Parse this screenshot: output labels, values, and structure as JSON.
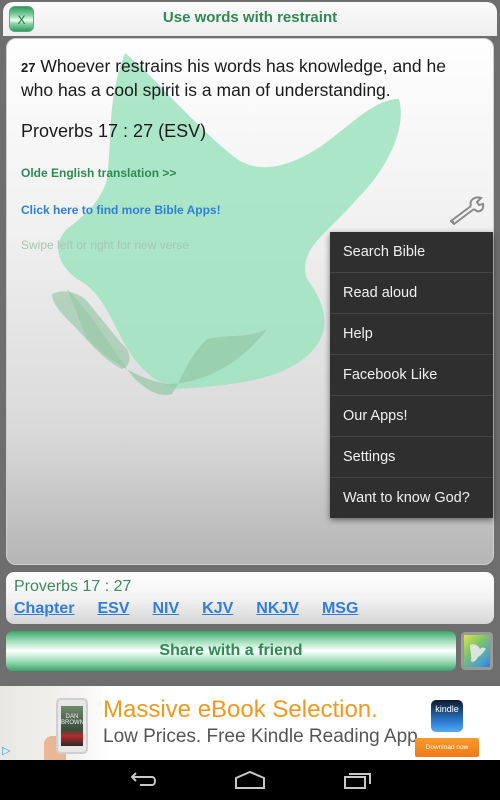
{
  "header": {
    "title": "Use words with restraint",
    "close_label": "X"
  },
  "verse": {
    "number": "27",
    "text": "Whoever restrains his words has knowledge, and he who has a cool spirit is a man of understanding.",
    "reference": "Proverbs 17 : 27  (ESV)"
  },
  "links": {
    "olde_english": "Olde English translation >>",
    "more_apps": "Click here to find more Bible Apps!",
    "swipe_hint": "Swipe left or right for new verse"
  },
  "menu": {
    "items": [
      {
        "label": "Search Bible"
      },
      {
        "label": "Read aloud"
      },
      {
        "label": "Help"
      },
      {
        "label": "Facebook Like"
      },
      {
        "label": "Our Apps!"
      },
      {
        "label": "Settings"
      },
      {
        "label": "Want to know God?"
      }
    ]
  },
  "ref_panel": {
    "title": "Proverbs 17 : 27",
    "versions": [
      {
        "label": "Chapter"
      },
      {
        "label": "ESV"
      },
      {
        "label": "NIV"
      },
      {
        "label": "KJV"
      },
      {
        "label": "NKJV"
      },
      {
        "label": "MSG"
      }
    ]
  },
  "share": {
    "label": "Share with a friend"
  },
  "ad": {
    "headline": "Massive eBook Selection.",
    "subline": "Low Prices. Free Kindle Reading App.",
    "book_author": "DAN BROWN",
    "kindle_label": "kindle",
    "download_label": "Download now",
    "ad_choices_glyph": "▷"
  },
  "icons": {
    "wrench": "wrench-icon",
    "back": "back-icon",
    "home": "home-icon",
    "recents": "recents-icon"
  },
  "colors": {
    "accent_green": "#2e8a52",
    "link_blue": "#2f7fd8",
    "ad_orange": "#ef9a1e",
    "menu_bg": "#2f2f2f"
  }
}
